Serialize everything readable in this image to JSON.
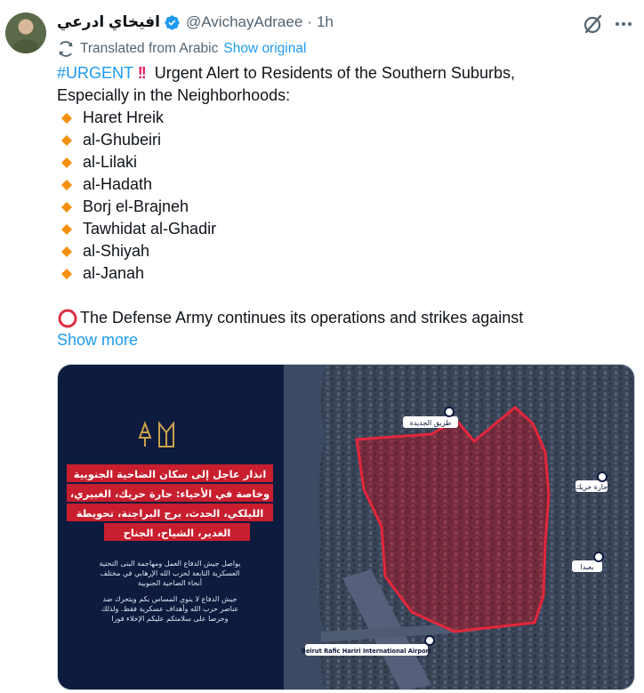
{
  "author": {
    "display_name": "افيخاي ادرعي",
    "handle": "@AvichayAdraee",
    "time": "1h",
    "separator": "·"
  },
  "translation": {
    "label": "Translated from Arabic",
    "link": "Show original"
  },
  "tweet": {
    "hashtag": "#URGENT",
    "alarm": "!!",
    "headline_1": "Urgent Alert to Residents of the Southern Suburbs,",
    "headline_2": "Especially in the Neighborhoods:",
    "neighborhoods": [
      "Haret Hreik",
      "al-Ghubeiri",
      "al-Lilaki",
      "al-Hadath",
      "Borj el-Brajneh",
      "Tawhidat al-Ghadir",
      "al-Shiyah",
      "al-Janah"
    ],
    "warning": "The Defense Army continues its operations and strikes against",
    "show_more": "Show more"
  },
  "image": {
    "headline_lines": [
      "انذار عاجل إلى سكان الضاحية الجنوبية",
      "وخاصة في الأحياء: حارة حريك، الغبيري،",
      "الليلكي، الحدث، برج البراجنة، تحويطة",
      "الغدير، الشياح، الجناح"
    ],
    "para1_lines": [
      "يواصل جيش الدفاع العمل ومهاجمة البنى التحتية",
      "العسكرية التابعة لحزب الله الإرهابي في مختلف",
      "أنحاء الضاحية الجنوبية"
    ],
    "para2_lines": [
      "جيش الدفاع لا ينوي المساس بكم ويتحرك ضد",
      "عناصر حزب الله وأهداف عسكرية فقط. ولذلك",
      "وحرصا على سلامتكم عليكم الإخلاء فورا"
    ],
    "pins": {
      "road": "طريق الجديدة",
      "haret": "حارة حريك",
      "baabda": "بعبدا",
      "airport": "Beirut Rafic Hariri International Airport"
    }
  },
  "colors": {
    "link_blue": "#1d9bf0",
    "panel_navy": "#0d1b3e",
    "zone_red": "#e3263b",
    "diamond_orange": "#f4900c"
  }
}
